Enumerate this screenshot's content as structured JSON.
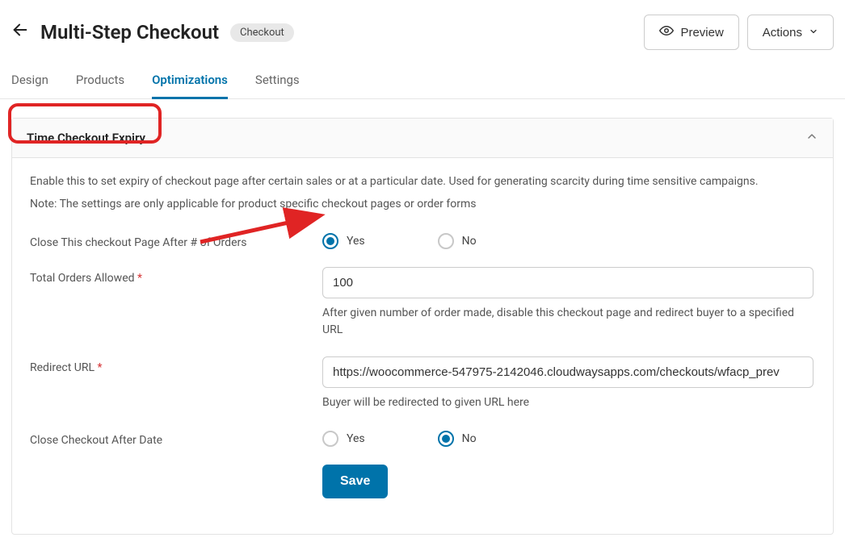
{
  "header": {
    "title": "Multi-Step Checkout",
    "type_badge": "Checkout",
    "preview_label": "Preview",
    "actions_label": "Actions"
  },
  "tabs": [
    {
      "label": "Design",
      "active": false
    },
    {
      "label": "Products",
      "active": false
    },
    {
      "label": "Optimizations",
      "active": true
    },
    {
      "label": "Settings",
      "active": false
    }
  ],
  "panel": {
    "title": "Time Checkout Expiry",
    "description": "Enable this to set expiry of checkout page after certain sales or at a particular date. Used for generating scarcity during time sensitive campaigns.",
    "note": "Note: The settings are only applicable for product specific checkout pages or order forms",
    "close_after_orders": {
      "label": "Close This checkout Page After # of Orders",
      "yes_label": "Yes",
      "no_label": "No",
      "value": "yes"
    },
    "total_orders": {
      "label": "Total Orders Allowed",
      "required_mark": "*",
      "value": "100",
      "help": "After given number of order made, disable this checkout page and redirect buyer to a specified URL"
    },
    "redirect_url": {
      "label": "Redirect URL",
      "required_mark": "*",
      "value": "https://woocommerce-547975-2142046.cloudwaysapps.com/checkouts/wfacp_prev",
      "help": "Buyer will be redirected to given URL here"
    },
    "close_after_date": {
      "label": "Close Checkout After Date",
      "yes_label": "Yes",
      "no_label": "No",
      "value": "no"
    },
    "save_label": "Save"
  }
}
